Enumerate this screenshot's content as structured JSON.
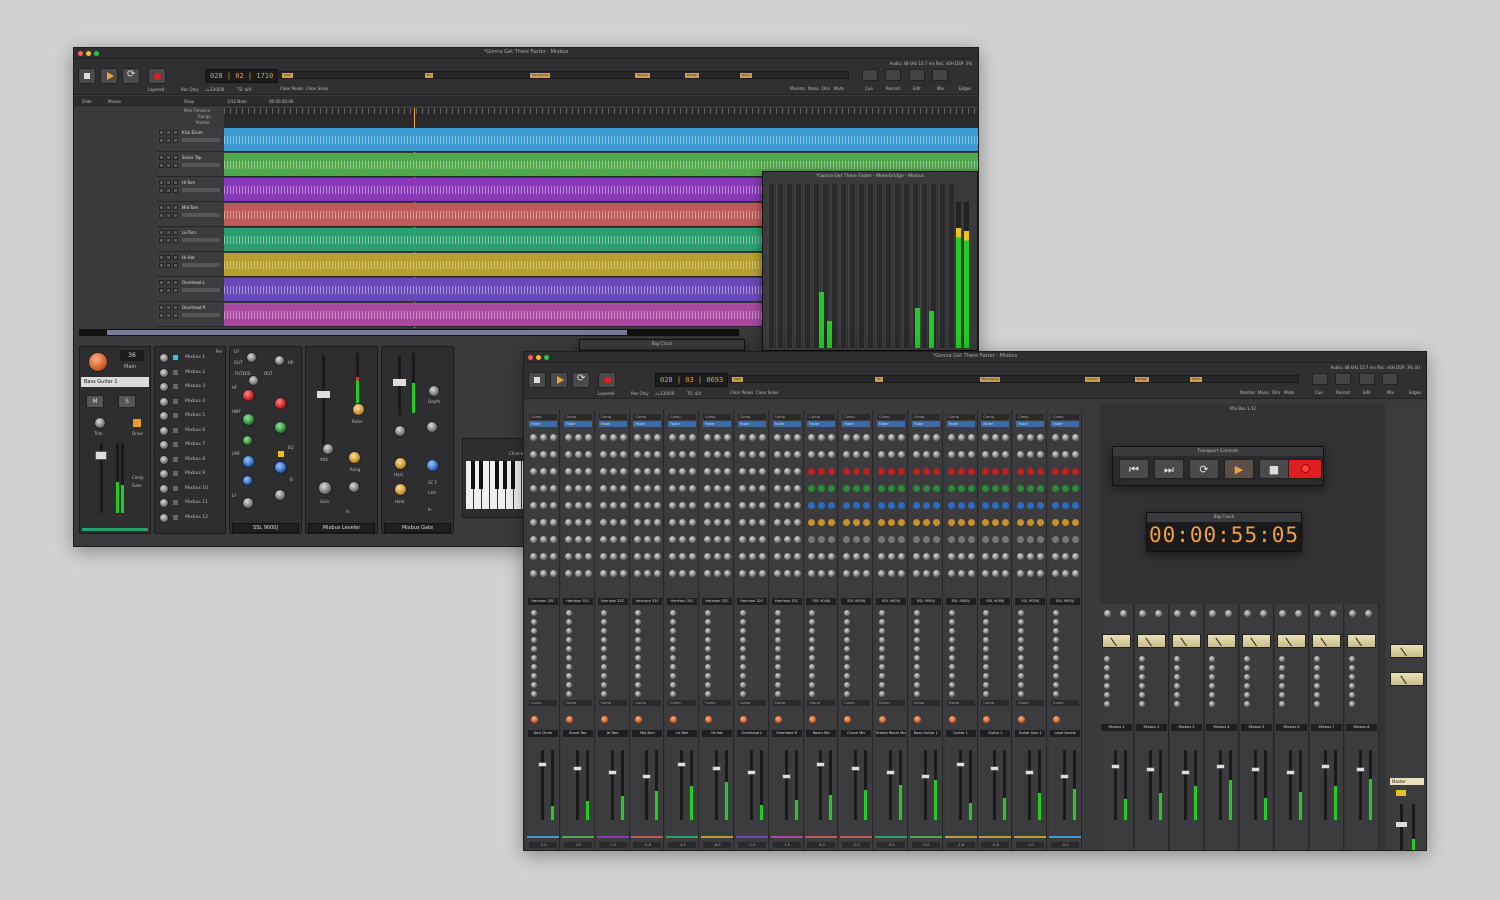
{
  "editor": {
    "title": "*Gonna Get There Faster - Mixbus",
    "status": "Audio: 48 kHz 10.7 ms   Rec: x6H   DSP: 3%",
    "clock": "028 | 02 | 1710",
    "clock_sub1": "♩=130/00",
    "clock_sub2": "TS: 4/4",
    "toolbar_labels": {
      "layered": "Layered",
      "rec_only": "Rec Only",
      "clear_peaks": "Clear Peaks",
      "clear_solos": "Clear Solos",
      "monitor": "Monitor",
      "mono": "Mono",
      "dim": "Dim",
      "mute": "Mute",
      "cue": "Cue",
      "record": "Record",
      "edit": "Edit",
      "mix": "Mix",
      "edges": "Edges"
    },
    "edit_toolbar": {
      "slide": "Slide",
      "mouse": "Mouse",
      "snap": "Snap",
      "grid": "1/32 Note",
      "position": "00:00:00:00"
    },
    "ruler_extra": [
      "Mini-Timeline",
      "Range",
      "Marker"
    ],
    "markers": [
      "Intro",
      "V1",
      "Pre-Chorus",
      "Chorus",
      "Bridge",
      "Outro"
    ],
    "tracks": [
      {
        "name": "Kick Drum",
        "color": "#3a9bd0"
      },
      {
        "name": "Snare Top",
        "color": "#4fa84a"
      },
      {
        "name": "Hi-Tom",
        "color": "#8a3ab8"
      },
      {
        "name": "Mid-Tom",
        "color": "#c05a5a"
      },
      {
        "name": "Lo-Tom",
        "color": "#2aa070"
      },
      {
        "name": "Hi-Hat",
        "color": "#b8a030"
      },
      {
        "name": "Overhead L",
        "color": "#6a4ab8"
      },
      {
        "name": "Overhead R",
        "color": "#a84aa0"
      }
    ],
    "meterbridge_title": "*Gonna Get There Faster - Meterbridge - Mixbus",
    "big_clock_title": "Big Clock",
    "strip": {
      "input_value": "36",
      "input_button": "Main",
      "track_name": "Bass Guitar 1",
      "mute": "M",
      "solo": "S",
      "trim": "Trim",
      "drive": "Drive",
      "comp": "Comp",
      "gate": "Gate",
      "sends": [
        "Mixbus 1",
        "Mixbus 2",
        "Mixbus 3",
        "Mixbus 4",
        "Mixbus 5",
        "Mixbus 6",
        "Mixbus 7",
        "Mixbus 8",
        "Mixbus 9",
        "Mixbus 10",
        "Mixbus 11",
        "Mixbus 12"
      ],
      "pre": "Pre",
      "eq_panel": "SSL 9000J",
      "eq_labels": {
        "lp": "LP",
        "out1": "OUT",
        "filters": "FILTERS",
        "out2": "OUT",
        "hp": "HP",
        "hf": "HF",
        "hmf": "HMF",
        "lmf": "LMF",
        "lf": "LF",
        "eq": "EQ",
        "b": "B"
      },
      "leveler_panel": "Mixbus Leveler",
      "leveler_labels": {
        "attack": "Attk",
        "gain": "Gain",
        "release": "Relse",
        "range": "Rang"
      },
      "gate_panel": "Mixbus Gate",
      "gate_labels": {
        "hyst": "Hyst",
        "hold": "Hold",
        "depth": "Depth",
        "sc_f": "SC F",
        "listen": "Lstn",
        "in": "In"
      },
      "in": "In"
    },
    "channel_label": "Channel"
  },
  "mixer": {
    "title": "*Gonna Get There Faster - Mixbus",
    "status": "Audio: 48 kHz 10.7 ms   Rec: x6H   DSP: 3% (4)",
    "clock": "028 | 03 | 0693",
    "strip_names": [
      "Kick Drum",
      "Snare Top",
      "Hi-Tom",
      "Mid-Tom",
      "Lo-Tom",
      "Hi-Hat",
      "Overhead L",
      "Overhead R",
      "Room Mic",
      "Chuck Mic",
      "Stereo Room Mic",
      "Bass Guitar 1",
      "Guitar 1",
      "Guitar 2",
      "Guitar Solo 1",
      "Lead Vocals"
    ],
    "strip_colors": [
      "#3a9bd0",
      "#4fa84a",
      "#8a3ab8",
      "#c05a5a",
      "#2aa070",
      "#b8a030",
      "#6a4ab8",
      "#a84aa0",
      "#c05a5a",
      "#c05a5a",
      "#2aa070",
      "#4fa84a",
      "#b8a030",
      "#b8a030",
      "#b8a030",
      "#3a9bd0"
    ],
    "eq_labels": [
      "Harrison 32C",
      "Harrison 32C",
      "Harrison 32C",
      "Harrison 32C",
      "Harrison 32C",
      "Harrison 32C",
      "Harrison 32C",
      "Harrison 32C",
      "SSL 9000J",
      "SSL 9000J",
      "SSL 9000J",
      "SSL 9000J",
      "SSL 9000J",
      "SSL 9000J",
      "SSL 9000J",
      "SSL 9000J"
    ],
    "plugin_labels": [
      "Comp",
      "Fader"
    ],
    "bus_title": "Mix Bus 1-12",
    "bus_names": [
      "Mixbus 1",
      "Mixbus 2",
      "Mixbus 3",
      "Mixbus 4",
      "Mixbus 5",
      "Mixbus 6",
      "Mixbus 7",
      "Mixbus 8"
    ],
    "master_name": "Master",
    "strip_values": [
      "-2.0",
      "-3.5",
      "-1.2",
      "-0.8",
      "-2.4",
      "-6.0",
      "-1.5",
      "-1.5",
      "-4.0",
      "-2.2",
      "-3.0",
      "-0.5",
      "-1.8",
      "-2.6",
      "-1.0",
      "-0.2"
    ],
    "transport_title": "Transport Controls",
    "big_clock_title": "Big Clock",
    "big_clock_value": "00:00:55:05"
  },
  "colors": {
    "accent": "#f0a040",
    "record": "#e02020",
    "meter": "#22cc22"
  },
  "icons": [
    "play-icon",
    "stop-icon",
    "loop-icon",
    "record-icon",
    "skip-back-icon",
    "skip-forward-icon"
  ]
}
